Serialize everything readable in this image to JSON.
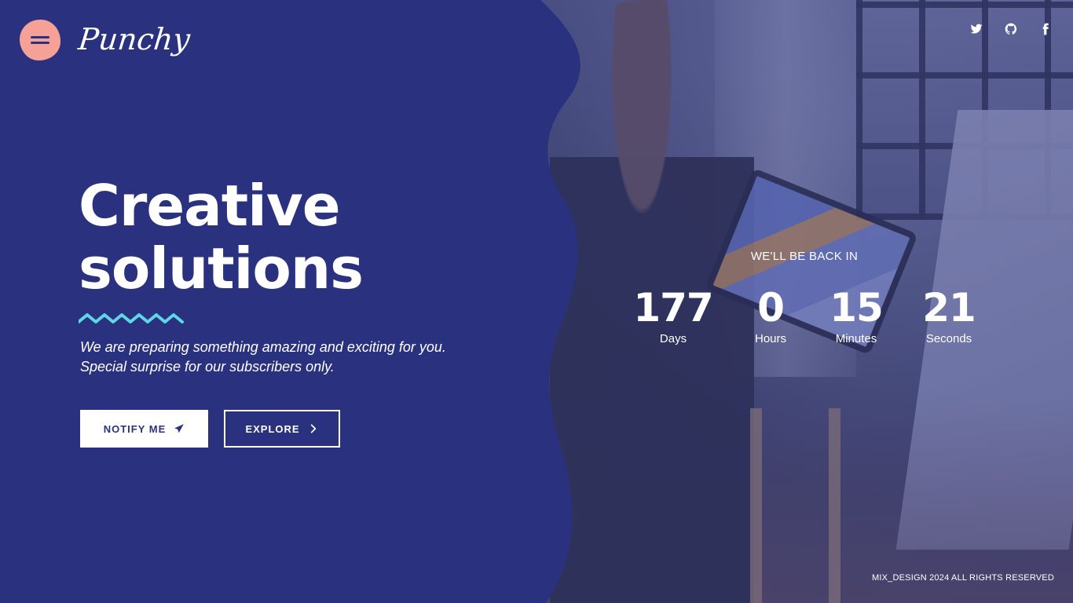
{
  "brand": {
    "logo_text": "Punchy",
    "accent_color": "#f5a198",
    "primary_color": "#2a327f",
    "zigzag_color": "#5fd6e6"
  },
  "header": {
    "menu_icon": "hamburger-menu-icon",
    "socials": [
      {
        "name": "twitter",
        "icon": "twitter-icon"
      },
      {
        "name": "github",
        "icon": "github-icon"
      },
      {
        "name": "facebook",
        "icon": "facebook-icon"
      }
    ]
  },
  "hero": {
    "headline_line1": "Creative",
    "headline_line2": "solutions",
    "tagline": "We are preparing something amazing and exciting for you. Special surprise for our subscribers only.",
    "notify_label": "NOTIFY ME",
    "notify_icon": "paper-plane-icon",
    "explore_label": "EXPLORE",
    "explore_icon": "chevron-right-icon"
  },
  "countdown": {
    "title": "WE'LL BE BACK IN",
    "days": {
      "value": "177",
      "label": "Days"
    },
    "hours": {
      "value": "0",
      "label": "Hours"
    },
    "minutes": {
      "value": "15",
      "label": "Minutes"
    },
    "seconds": {
      "value": "21",
      "label": "Seconds"
    }
  },
  "footer": {
    "copyright": "MIX_DESIGN 2024 ALL RIGHTS RESERVED"
  }
}
